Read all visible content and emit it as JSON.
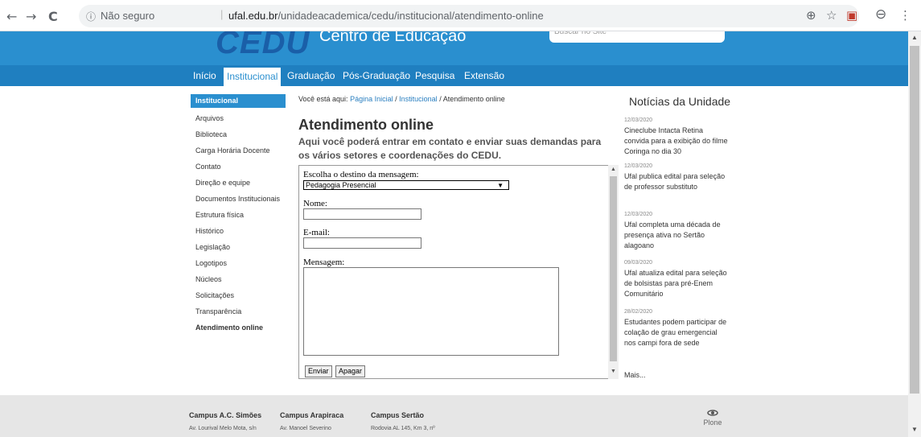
{
  "browser": {
    "back_icon": "←",
    "forward_icon": "→",
    "reload_icon": "C",
    "info_icon": "ⓘ",
    "insecure_label": "Não seguro",
    "url_host": "ufal.edu.br",
    "url_path": "/unidadeacademica/cedu/institucional/atendimento-online",
    "zoom_icon": "⊕",
    "star_icon": "☆",
    "ext_icon": "▣",
    "profile_icon": "⊖",
    "menu_icon": "⋮"
  },
  "header": {
    "logo": "CEDU",
    "subtitle": "Centro de Educação",
    "search_placeholder": "Buscar no Site"
  },
  "navbar": {
    "items": [
      "Início",
      "Institucional",
      "Graduação",
      "Pós-Graduação",
      "Pesquisa",
      "Extensão"
    ],
    "active": "Institucional"
  },
  "sidebar": {
    "heading": "Institucional",
    "items": [
      "Arquivos",
      "Biblioteca",
      "Carga Horária Docente",
      "Contato",
      "Direção e equipe",
      "Documentos Institucionais",
      "Estrutura física",
      "Histórico",
      "Legislação",
      "Logotipos",
      "Núcleos",
      "Solicitações",
      "Transparência",
      "Atendimento online"
    ]
  },
  "breadcrumb": {
    "prefix": "Você está aqui:",
    "home": "Página Inicial",
    "sep1": "/",
    "section": "Institucional",
    "sep2": "/",
    "current": "Atendimento online"
  },
  "main": {
    "title": "Atendimento online",
    "lead": "Aqui você poderá entrar em contato e enviar suas demandas para os vários setores e coordenações do CEDU."
  },
  "form": {
    "dest_label": "Escolha o destino da mensagem:",
    "dest_value": "Pedagogia Presencial",
    "dest_arrow": "▼",
    "name_label": "Nome:",
    "email_label": "E-mail:",
    "message_label": "Mensagem:",
    "send_label": "Enviar",
    "clear_label": "Apagar"
  },
  "news": {
    "heading": "Notícias da Unidade",
    "items": [
      {
        "date": "12/03/2020",
        "text": "Cineclube Intacta Retina convida para a exibição do filme Coringa no dia 30"
      },
      {
        "date": "12/03/2020",
        "text": "Ufal publica edital para seleção de professor substituto"
      },
      {
        "date": "12/03/2020",
        "text": "Ufal completa uma década de presença ativa no Sertão alagoano"
      },
      {
        "date": "09/03/2020",
        "text": "Ufal atualiza edital para seleção de bolsistas para pré-Enem Comunitário"
      },
      {
        "date": "28/02/2020",
        "text": "Estudantes podem participar de colação de grau emergencial nos campi fora de sede"
      }
    ],
    "more": "Mais..."
  },
  "footer": {
    "campuses": [
      {
        "name": "Campus A.C. Simões",
        "address": "Av. Lourival Melo Mota, s/n"
      },
      {
        "name": "Campus Arapiraca",
        "address": "Av. Manoel Severino"
      },
      {
        "name": "Campus Sertão",
        "address": "Rodovia AL 145, Km 3, nº"
      }
    ],
    "plone_label": "Plone"
  }
}
